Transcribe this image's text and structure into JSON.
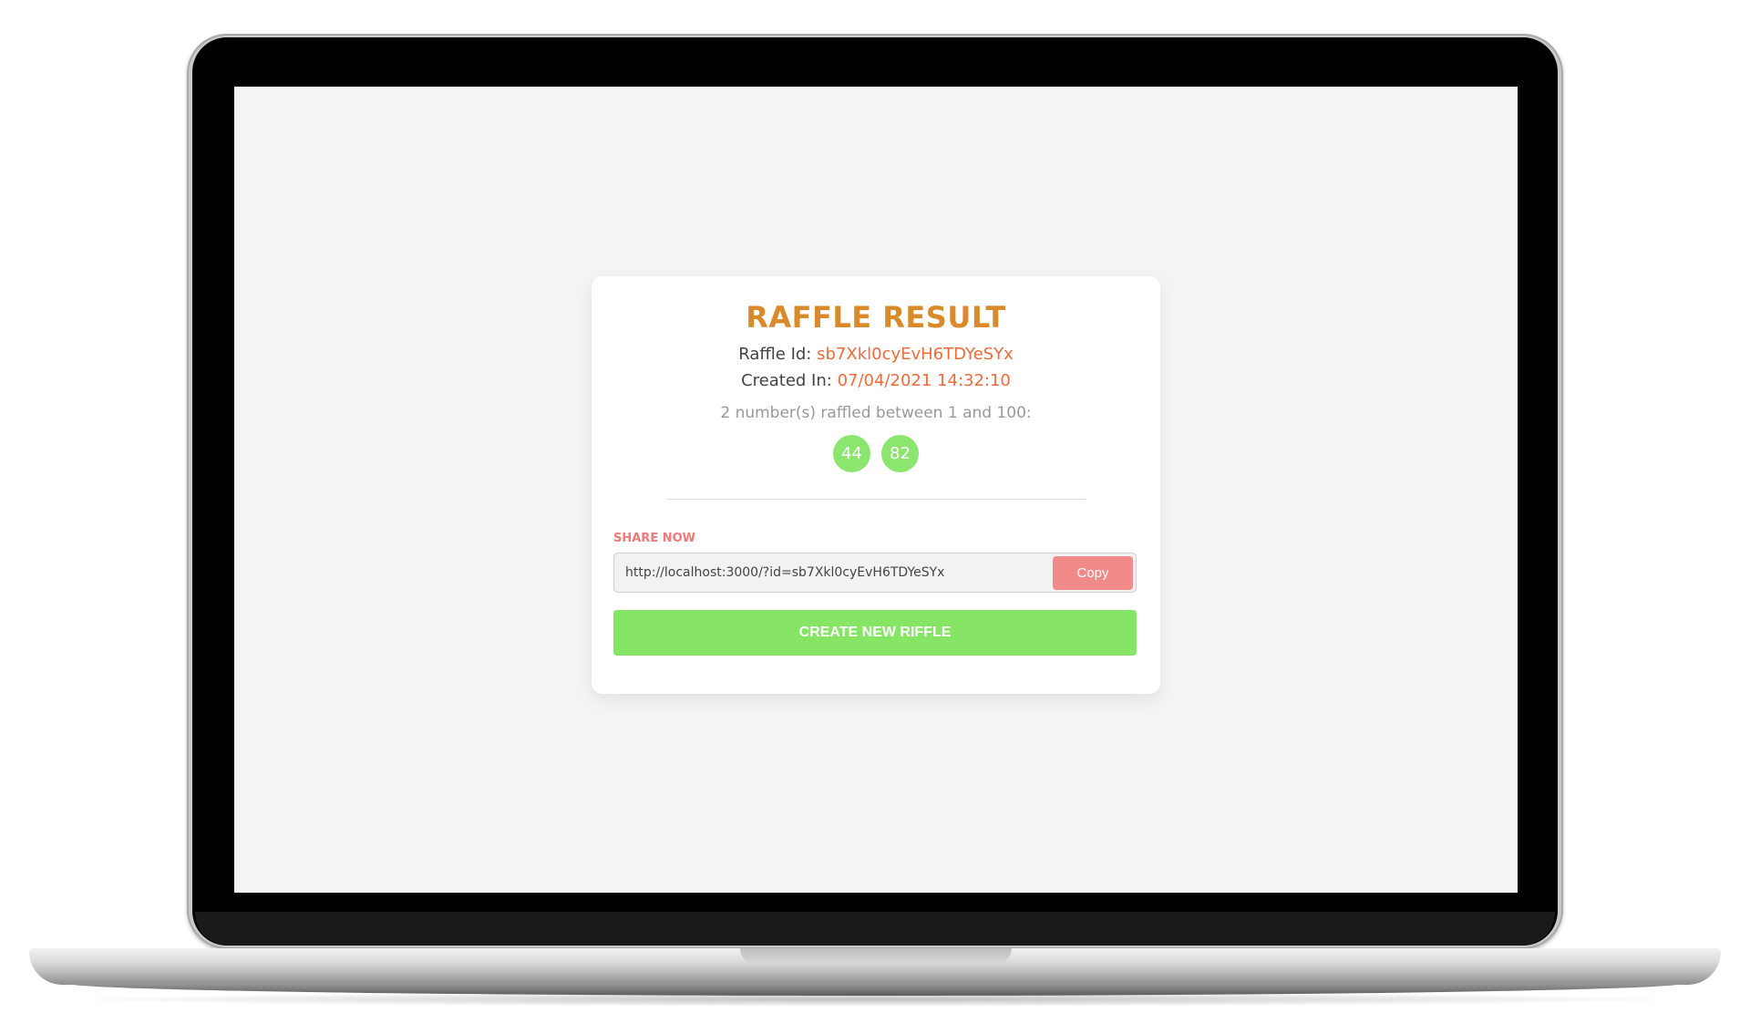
{
  "card": {
    "title": "RAFFLE RESULT",
    "raffle_id_label": "Raffle Id:",
    "raffle_id_value": "sb7Xkl0cyEvH6TDYeSYx",
    "created_label": "Created In:",
    "created_value": "07/04/2021 14:32:10",
    "summary": "2 number(s) raffled between 1 and 100:",
    "numbers": [
      "44",
      "82"
    ]
  },
  "share": {
    "label": "SHARE NOW",
    "url": "http://localhost:3000/?id=sb7Xkl0cyEvH6TDYeSYx",
    "copy_label": "Copy"
  },
  "actions": {
    "create_label": "CREATE NEW RIFFLE"
  },
  "colors": {
    "title": "#d98a2b",
    "value_text": "#f06a3a",
    "number_ball": "#8be56e",
    "share_label": "#f07878",
    "copy_button": "#f28a8a",
    "create_button": "#87e565",
    "screen_background": "#f4f4f4"
  }
}
